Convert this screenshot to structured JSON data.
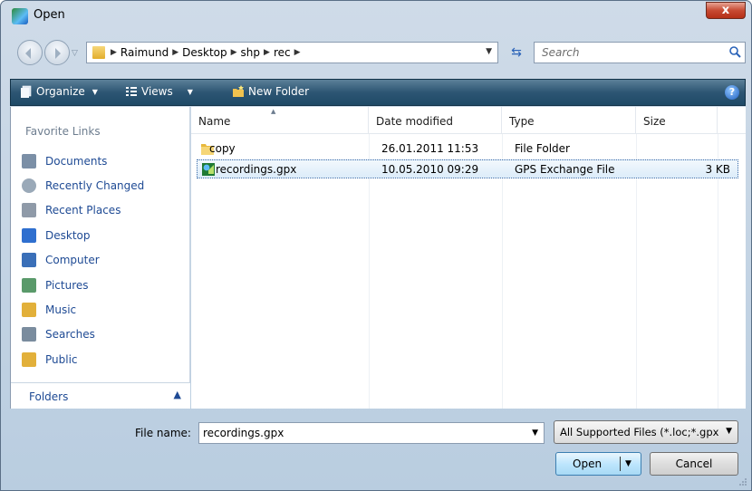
{
  "window": {
    "title": "Open",
    "close_glyph": "x"
  },
  "address": {
    "crumbs": [
      "Raimund",
      "Desktop",
      "shp",
      "rec"
    ],
    "search_placeholder": "Search"
  },
  "toolbar": {
    "organize": "Organize",
    "views": "Views",
    "new_folder": "New Folder",
    "help_glyph": "?"
  },
  "sidebar": {
    "header": "Favorite Links",
    "items": [
      {
        "label": "Documents",
        "icon": "documents-icon",
        "color": "#7b8fa6"
      },
      {
        "label": "Recently Changed",
        "icon": "recently-changed-icon",
        "color": "#9aa9b8"
      },
      {
        "label": "Recent Places",
        "icon": "recent-places-icon",
        "color": "#8f9aa8"
      },
      {
        "label": "Desktop",
        "icon": "desktop-icon",
        "color": "#2f6fcf"
      },
      {
        "label": "Computer",
        "icon": "computer-icon",
        "color": "#3a6fb8"
      },
      {
        "label": "Pictures",
        "icon": "pictures-icon",
        "color": "#5a9a6a"
      },
      {
        "label": "Music",
        "icon": "music-icon",
        "color": "#e2b03a"
      },
      {
        "label": "Searches",
        "icon": "searches-icon",
        "color": "#7a8c9e"
      },
      {
        "label": "Public",
        "icon": "public-icon",
        "color": "#e2b03a"
      }
    ],
    "folders_label": "Folders"
  },
  "files": {
    "columns": [
      "Name",
      "Date modified",
      "Type",
      "Size"
    ],
    "rows": [
      {
        "name": "copy",
        "date": "26.01.2011 11:53",
        "type": "File Folder",
        "size": "",
        "icon": "folder-icon",
        "selected": false
      },
      {
        "name": "recordings.gpx",
        "date": "10.05.2010 09:29",
        "type": "GPS Exchange File",
        "size": "3 KB",
        "icon": "gpx-file-icon",
        "selected": true
      }
    ]
  },
  "footer": {
    "filename_label": "File name:",
    "filename_value": "recordings.gpx",
    "filter_value": "All Supported Files (*.loc;*.gpx",
    "open_label": "Open",
    "cancel_label": "Cancel"
  },
  "colors": {
    "toolbar": "#2d5573",
    "link": "#1e4a94",
    "selection": "#dcecf9"
  }
}
